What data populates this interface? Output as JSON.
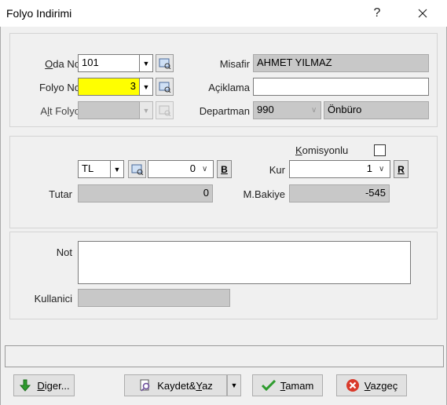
{
  "window": {
    "title": "Folyo Indirimi",
    "help_label": "?",
    "close_label": "✕"
  },
  "room": {
    "oda_no_label_first": "O",
    "oda_no_label_rest": "da No",
    "oda_no_value": "101",
    "folyo_no_label": "Folyo No",
    "folyo_no_value": "3",
    "alt_folyo_label_a": "A",
    "alt_folyo_label_l": "l",
    "alt_folyo_label_rest": "t Folyo",
    "alt_folyo_value": "",
    "misafir_label": "Misafir",
    "misafir_value": "AHMET YILMAZ",
    "aciklama_label": "Açiklama",
    "aciklama_value": "",
    "departman_label": "Departman",
    "departman_code": "990",
    "departman_name": "Önbüro"
  },
  "amount": {
    "komisyonlu_first": "K",
    "komisyonlu_rest": "omisyonlu",
    "currency": "TL",
    "currency_value": "0",
    "b_button": "B",
    "kur_label": "Kur",
    "kur_value": "1",
    "r_button": "R",
    "tutar_label": "Tutar",
    "tutar_value": "0",
    "mbakiye_label": "M.Bakiye",
    "mbakiye_value": "-545"
  },
  "notes": {
    "not_label": "Not",
    "not_value": "",
    "kullanici_label": "Kullanici",
    "kullanici_value": ""
  },
  "buttons": {
    "diger_first": "D",
    "diger_rest": "iger...",
    "kaydet_pre": "Kaydet&",
    "kaydet_y": "Y",
    "kaydet_post": "az",
    "tamam_first": "T",
    "tamam_rest": "amam",
    "vazgec_first": "V",
    "vazgec_rest": "azgeç"
  },
  "colors": {
    "highlight_yellow": "#ffff00",
    "readonly_gray": "#c8c8c8",
    "ok_green": "#2e9b2e",
    "cancel_red": "#d93a2b"
  }
}
